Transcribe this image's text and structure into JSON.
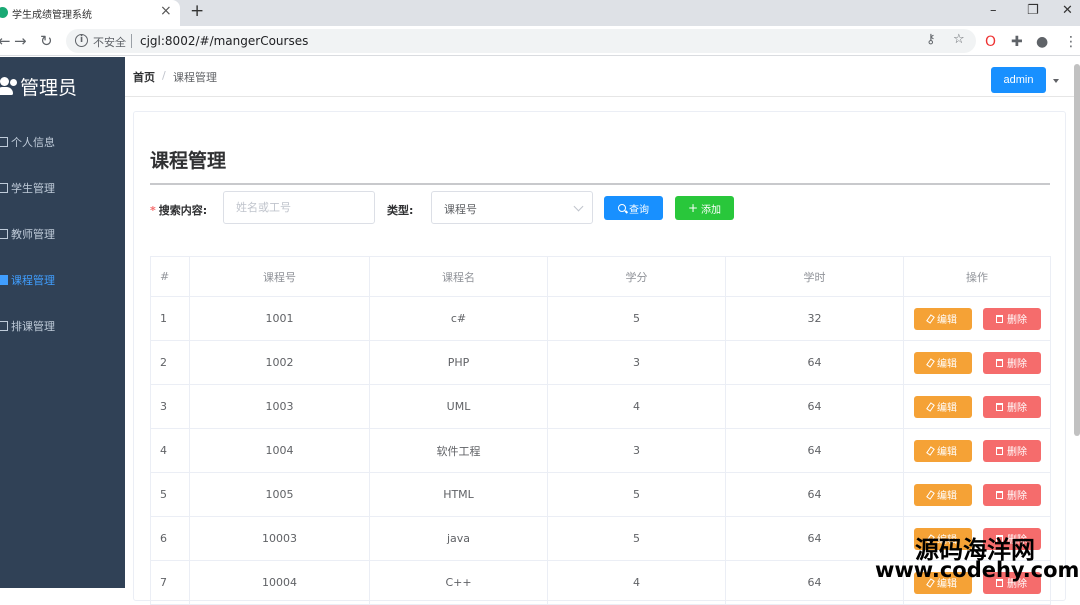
{
  "browser": {
    "tab_title": "学生成绩管理系统",
    "insecure_label": "不安全",
    "url": "cjgl:8002/#/mangerCourses"
  },
  "sidebar": {
    "brand": "管理员",
    "items": [
      {
        "label": "个人信息",
        "active": false
      },
      {
        "label": "学生管理",
        "active": false
      },
      {
        "label": "教师管理",
        "active": false
      },
      {
        "label": "课程管理",
        "active": true
      },
      {
        "label": "排课管理",
        "active": false
      }
    ]
  },
  "header": {
    "breadcrumb_home": "首页",
    "breadcrumb_sep": "/",
    "breadcrumb_current": "课程管理",
    "user_label": "admin"
  },
  "page": {
    "title": "课程管理",
    "search_label": "搜索内容:",
    "search_placeholder": "姓名或工号",
    "type_label": "类型:",
    "type_value": "课程号",
    "query_label": "查询",
    "add_label": "添加"
  },
  "table": {
    "headers": [
      "#",
      "课程号",
      "课程名",
      "学分",
      "学时",
      "操作"
    ],
    "edit_label": "编辑",
    "delete_label": "删除",
    "rows": [
      [
        "1",
        "1001",
        "c#",
        "5",
        "32"
      ],
      [
        "2",
        "1002",
        "PHP",
        "3",
        "64"
      ],
      [
        "3",
        "1003",
        "UML",
        "4",
        "64"
      ],
      [
        "4",
        "1004",
        "软件工程",
        "3",
        "64"
      ],
      [
        "5",
        "1005",
        "HTML",
        "5",
        "64"
      ],
      [
        "6",
        "10003",
        "java",
        "5",
        "64"
      ],
      [
        "7",
        "10004",
        "C++",
        "4",
        "64"
      ]
    ]
  },
  "watermark": {
    "cn": "源码海洋网",
    "en": "www.codehy.com"
  },
  "colors": {
    "sidebar_bg": "#304156",
    "primary": "#1890ff",
    "success": "#29c73b",
    "warning": "#f5a236",
    "danger": "#f56c6c"
  }
}
